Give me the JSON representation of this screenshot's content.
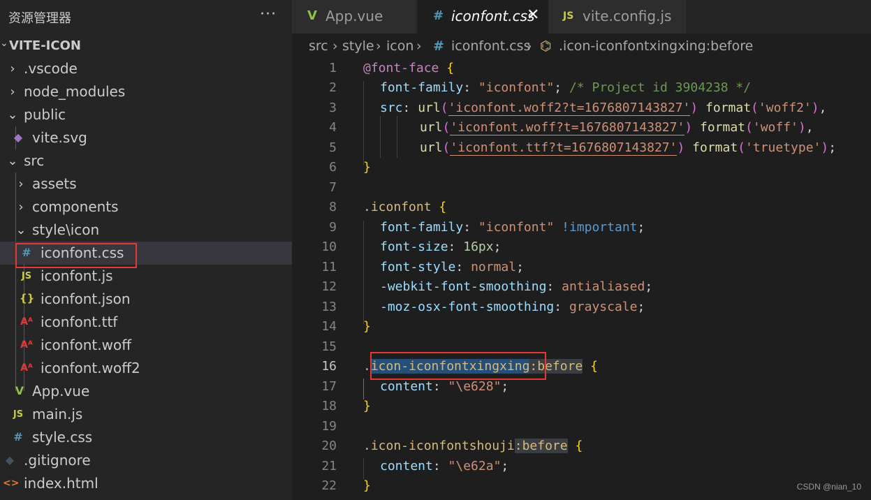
{
  "colors": {
    "css_icon": "#519aba",
    "js_icon": "#cbcb41",
    "json_icon": "#cbcb41",
    "font_icon": "#e53935",
    "vue_icon": "#8dc149",
    "git_icon": "#41535b",
    "html_icon": "#e37933",
    "svg_icon": "#a074c4",
    "highlight_box": "#e53935"
  },
  "sidebar": {
    "title": "资源管理器",
    "more": "···",
    "project": "VITE-ICON",
    "items": [
      {
        "label": ".vscode",
        "icon": "chevron-right"
      },
      {
        "label": "node_modules",
        "icon": "chevron-right"
      },
      {
        "label": "public",
        "icon": "chevron-down"
      },
      {
        "label": "vite.svg",
        "icon": "svg-file-icon"
      },
      {
        "label": "src",
        "icon": "chevron-down"
      },
      {
        "label": "assets",
        "icon": "chevron-right"
      },
      {
        "label": "components",
        "icon": "chevron-right"
      },
      {
        "label": "style\\icon",
        "icon": "chevron-down"
      },
      {
        "label": "iconfont.css",
        "icon": "css-file-icon"
      },
      {
        "label": "iconfont.js",
        "icon": "js-file-icon"
      },
      {
        "label": "iconfont.json",
        "icon": "json-file-icon"
      },
      {
        "label": "iconfont.ttf",
        "icon": "font-file-icon"
      },
      {
        "label": "iconfont.woff",
        "icon": "font-file-icon"
      },
      {
        "label": "iconfont.woff2",
        "icon": "font-file-icon"
      },
      {
        "label": "App.vue",
        "icon": "vue-file-icon"
      },
      {
        "label": "main.js",
        "icon": "js-file-icon"
      },
      {
        "label": "style.css",
        "icon": "css-file-icon"
      },
      {
        "label": ".gitignore",
        "icon": "git-file-icon"
      },
      {
        "label": "index.html",
        "icon": "html-file-icon"
      }
    ]
  },
  "tabs": [
    {
      "label": "App.vue",
      "icon_glyph": "V",
      "active": false
    },
    {
      "label": "iconfont.css",
      "icon_glyph": "#",
      "active": true,
      "close": "✕"
    },
    {
      "label": "vite.config.js",
      "icon_glyph": "JS",
      "active": false
    }
  ],
  "breadcrumb": {
    "parts": [
      "src",
      "style",
      "icon",
      "iconfont.css",
      ".icon-iconfontxingxing:before"
    ],
    "sep": "›"
  },
  "editor": {
    "line_numbers": [
      "1",
      "2",
      "3",
      "4",
      "5",
      "6",
      "7",
      "8",
      "9",
      "10",
      "11",
      "12",
      "13",
      "14",
      "15",
      "16",
      "17",
      "18",
      "19",
      "20",
      "21",
      "22"
    ],
    "current_line": "16",
    "lines": {
      "l1": {
        "at": "@font-face",
        "brace": " {"
      },
      "l2": {
        "prop": "font-family",
        "colon": ": ",
        "str": "\"iconfont\"",
        "semi": "; ",
        "cmt": "/* Project id 3904238 */"
      },
      "l3": {
        "prop": "src",
        "colon": ": ",
        "fn": "url",
        "op": "(",
        "str": "'iconfont.woff2?t=1676807143827'",
        "cp": ")",
        "fn2": " format",
        "op2": "(",
        "str2": "'woff2'",
        "cp2": ")",
        "end": ","
      },
      "l4": {
        "fn": "url",
        "op": "(",
        "str": "'iconfont.woff?t=1676807143827'",
        "cp": ")",
        "fn2": " format",
        "op2": "(",
        "str2": "'woff'",
        "cp2": ")",
        "end": ","
      },
      "l5": {
        "fn": "url",
        "op": "(",
        "str": "'iconfont.ttf?t=1676807143827'",
        "cp": ")",
        "fn2": " format",
        "op2": "(",
        "str2": "'truetype'",
        "cp2": ")",
        "end": ";"
      },
      "l6": {
        "brace": "}"
      },
      "l8": {
        "sel": ".iconfont",
        "brace": " {"
      },
      "l9": {
        "prop": "font-family",
        "colon": ": ",
        "str": "\"iconfont\"",
        "kw": " !important",
        "semi": ";"
      },
      "l10": {
        "prop": "font-size",
        "colon": ": ",
        "num": "16px",
        "semi": ";"
      },
      "l11": {
        "prop": "font-style",
        "colon": ": ",
        "val": "normal",
        "semi": ";"
      },
      "l12": {
        "prop": "-webkit-font-smoothing",
        "colon": ": ",
        "val": "antialiased",
        "semi": ";"
      },
      "l13": {
        "prop": "-moz-osx-font-smoothing",
        "colon": ": ",
        "val": "grayscale",
        "semi": ";"
      },
      "l14": {
        "brace": "}"
      },
      "l16": {
        "dot": ".",
        "sel": "icon-iconfontxingxing",
        "pseudo": ":before",
        "brace": " {"
      },
      "l17": {
        "prop": "content",
        "colon": ": ",
        "str": "\"\\e628\"",
        "semi": ";"
      },
      "l18": {
        "brace": "}"
      },
      "l20": {
        "sel": ".icon-iconfontshouji",
        "pseudo": ":before",
        "brace": " {"
      },
      "l21": {
        "prop": "content",
        "colon": ": ",
        "str": "\"\\e62a\"",
        "semi": ";"
      },
      "l22": {
        "brace": "}"
      }
    }
  },
  "watermark": "CSDN @nian_10"
}
